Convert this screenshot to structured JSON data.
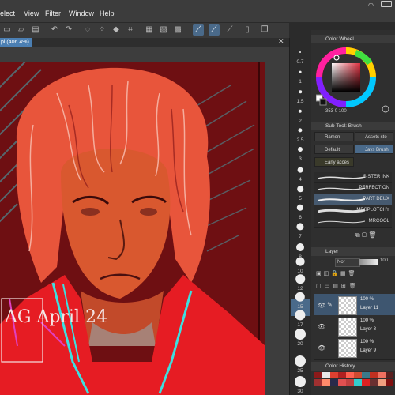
{
  "menu": [
    "elect",
    "View",
    "Filter",
    "Window",
    "Help"
  ],
  "doc_tab": "pi (406.4%)",
  "ruler_labels": [
    "0.7",
    "1",
    "1.5",
    "2",
    "2.5",
    "3",
    "4",
    "5",
    "6",
    "7",
    "8",
    "10",
    "12",
    "15",
    "17",
    "20",
    "25",
    "30"
  ],
  "color_wheel": {
    "title": "Color Wheel",
    "values": "353 0 100",
    "hue_color": "#e03040",
    "value_label_h": "353",
    "value_label_s": "0",
    "value_label_v": "100"
  },
  "sub_tool": {
    "title": "Sub Tool: Brush",
    "groups": [
      "Ramen",
      "Assets sto",
      "Default",
      "Jays Brush",
      "Early acces"
    ],
    "brushes": [
      "SISTER INK",
      "PERFECTION",
      "PART DEUX",
      "MRSPLOTCHY",
      "MRCOOL"
    ],
    "selected_brush": "PART DEUX"
  },
  "layer_panel": {
    "title": "Layer",
    "blend_mode": "Nor",
    "opacity": "100",
    "layers": [
      {
        "opacity": "100 %",
        "name": "Layer 11",
        "selected": true
      },
      {
        "opacity": "100 %",
        "name": "Layer 8",
        "selected": false
      },
      {
        "opacity": "100 %",
        "name": "Layer 9",
        "selected": false
      }
    ]
  },
  "color_history": {
    "title": "Color History",
    "swatches": [
      "#8c1a1a",
      "#e8e8e8",
      "#e04030",
      "#b02020",
      "#ff6050",
      "#d04a30",
      "#3a7a8a",
      "#c03020",
      "#f07060",
      "#5a2020",
      "#a03030",
      "#ff8a6a",
      "#2a2a4a",
      "#e05050",
      "#c04040",
      "#33cccc",
      "#dd2222",
      "#6a3030",
      "#f0a080",
      "#801010"
    ]
  },
  "signature": "AG April 24"
}
